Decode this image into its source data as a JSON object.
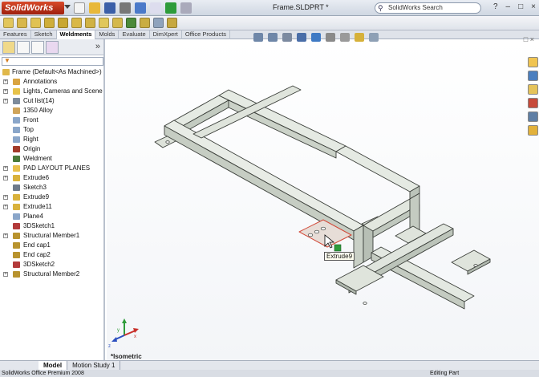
{
  "app": {
    "logo": "SolidWorks",
    "document_title": "Frame.SLDPRT *",
    "search_placeholder": "SolidWorks Search"
  },
  "command_tabs": [
    "Features",
    "Sketch",
    "Weldments",
    "Molds",
    "Evaluate",
    "DimXpert",
    "Office Products"
  ],
  "active_tab": "Weldments",
  "tree": {
    "root": "Frame  (Default<As Machined>)",
    "items": [
      {
        "label": "Annotations",
        "expand": true,
        "icon": "annotations-icon",
        "color": "#d9a441"
      },
      {
        "label": "Lights, Cameras and Scene",
        "expand": true,
        "icon": "lights-icon",
        "color": "#e6c24a"
      },
      {
        "label": "Cut list(14)",
        "expand": true,
        "icon": "cutlist-icon",
        "color": "#7d8b9b"
      },
      {
        "label": "1350 Alloy",
        "expand": false,
        "icon": "material-icon",
        "color": "#cfa45a"
      },
      {
        "label": "Front",
        "expand": false,
        "icon": "plane-icon",
        "color": "#8aa6c9"
      },
      {
        "label": "Top",
        "expand": false,
        "icon": "plane-icon",
        "color": "#8aa6c9"
      },
      {
        "label": "Right",
        "expand": false,
        "icon": "plane-icon",
        "color": "#8aa6c9"
      },
      {
        "label": "Origin",
        "expand": false,
        "icon": "origin-icon",
        "color": "#a23b2b"
      },
      {
        "label": "Weldment",
        "expand": false,
        "icon": "weldment-icon",
        "color": "#4a7a3a"
      },
      {
        "label": "PAD LAYOUT PLANES",
        "expand": true,
        "icon": "folder-icon",
        "color": "#e8c04c"
      },
      {
        "label": "Extrude6",
        "expand": true,
        "icon": "extrude-icon",
        "color": "#d9b23c"
      },
      {
        "label": "Sketch3",
        "expand": false,
        "icon": "sketch-icon",
        "color": "#6e7a8a"
      },
      {
        "label": "Extrude9",
        "expand": true,
        "icon": "extrude-icon",
        "color": "#d9b23c"
      },
      {
        "label": "Extrude11",
        "expand": true,
        "icon": "extrude-icon",
        "color": "#d9b23c"
      },
      {
        "label": "Plane4",
        "expand": false,
        "icon": "plane-icon",
        "color": "#8aa6c9"
      },
      {
        "label": "3DSketch1",
        "expand": false,
        "icon": "sketch3d-icon",
        "color": "#b33a3a"
      },
      {
        "label": "Structural Member1",
        "expand": true,
        "icon": "structural-member-icon",
        "color": "#b8932e"
      },
      {
        "label": "End cap1",
        "expand": false,
        "icon": "endcap-icon",
        "color": "#b8932e"
      },
      {
        "label": "End cap2",
        "expand": false,
        "icon": "endcap-icon",
        "color": "#b8932e"
      },
      {
        "label": "3DSketch2",
        "expand": false,
        "icon": "sketch3d-icon",
        "color": "#b33a3a"
      },
      {
        "label": "Structural Member2",
        "expand": true,
        "icon": "structural-member-icon",
        "color": "#b8932e"
      }
    ]
  },
  "viewport": {
    "tooltip": "Extrude9",
    "view_label": "*Isometric"
  },
  "bottom_tabs": [
    "Model",
    "Motion Study 1"
  ],
  "status": {
    "left": "SolidWorks Office Premium 2008",
    "right": "Editing Part"
  },
  "colors": {
    "part_face": "#c8cfc6",
    "part_top": "#e3e8e1",
    "part_edge": "#3b3f3a",
    "selection": "#d24a3a"
  }
}
